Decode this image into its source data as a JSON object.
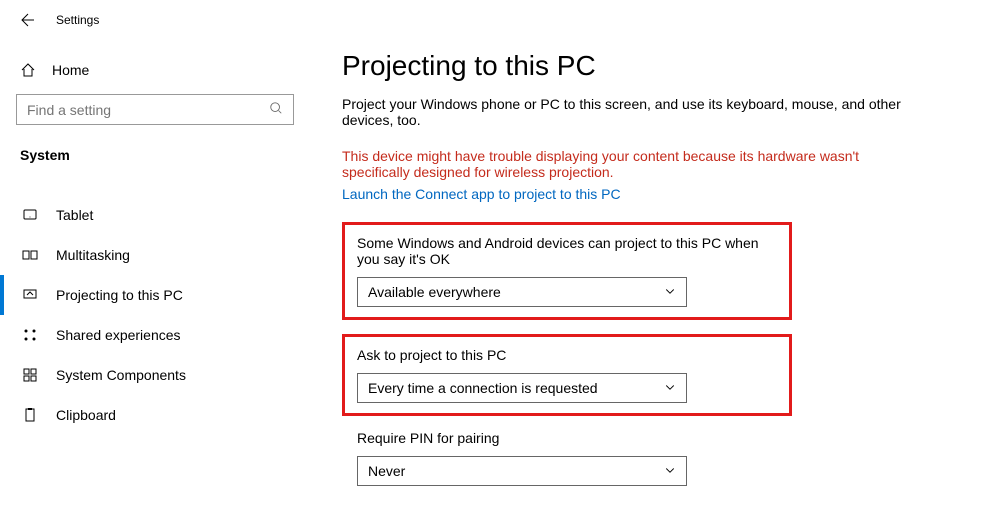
{
  "header": {
    "title": "Settings"
  },
  "home": {
    "label": "Home"
  },
  "search": {
    "placeholder": "Find a setting"
  },
  "section": {
    "label": "System"
  },
  "sidebar": {
    "items": [
      {
        "label": "Tablet"
      },
      {
        "label": "Multitasking"
      },
      {
        "label": "Projecting to this PC"
      },
      {
        "label": "Shared experiences"
      },
      {
        "label": "System Components"
      },
      {
        "label": "Clipboard"
      }
    ]
  },
  "main": {
    "title": "Projecting to this PC",
    "subtitle": "Project your Windows phone or PC to this screen, and use its keyboard, mouse, and other devices, too.",
    "warning": "This device might have trouble displaying your content because its hardware wasn't specifically designed for wireless projection.",
    "link": "Launch the Connect app to project to this PC",
    "groups": [
      {
        "label": "Some Windows and Android devices can project to this PC when you say it's OK",
        "value": "Available everywhere"
      },
      {
        "label": "Ask to project to this PC",
        "value": "Every time a connection is requested"
      },
      {
        "label": "Require PIN for pairing",
        "value": "Never"
      }
    ]
  }
}
